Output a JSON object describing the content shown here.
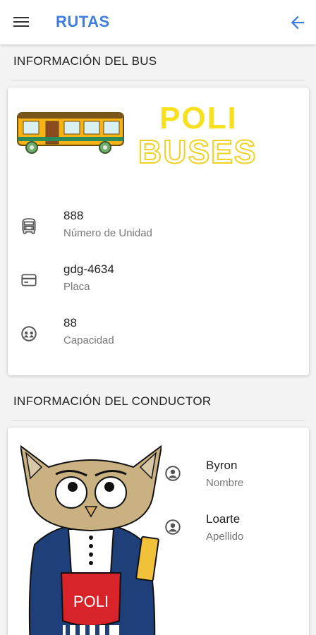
{
  "appbar": {
    "title": "RUTAS",
    "menu_icon": "menu-icon",
    "back_icon": "arrow-back-icon",
    "accent_color": "#3d7de0"
  },
  "bus_section": {
    "title": "INFORMACIÓN DEL BUS",
    "logo_text_top": "POLI",
    "logo_text_bottom": "BUSES",
    "items": [
      {
        "icon": "bus-icon",
        "value": "888",
        "label": "Número de Unidad"
      },
      {
        "icon": "card-icon",
        "value": "gdg-4634",
        "label": "Placa"
      },
      {
        "icon": "group-icon",
        "value": "88",
        "label": "Capacidad"
      }
    ]
  },
  "driver_section": {
    "title": "INFORMACIÓN DEL CONDUCTOR",
    "mascot_text": "POLI",
    "items": [
      {
        "icon": "account-circle-icon",
        "value": "Byron",
        "label": "Nombre"
      },
      {
        "icon": "account-circle-icon",
        "value": "Loarte",
        "label": "Apellido"
      }
    ]
  }
}
